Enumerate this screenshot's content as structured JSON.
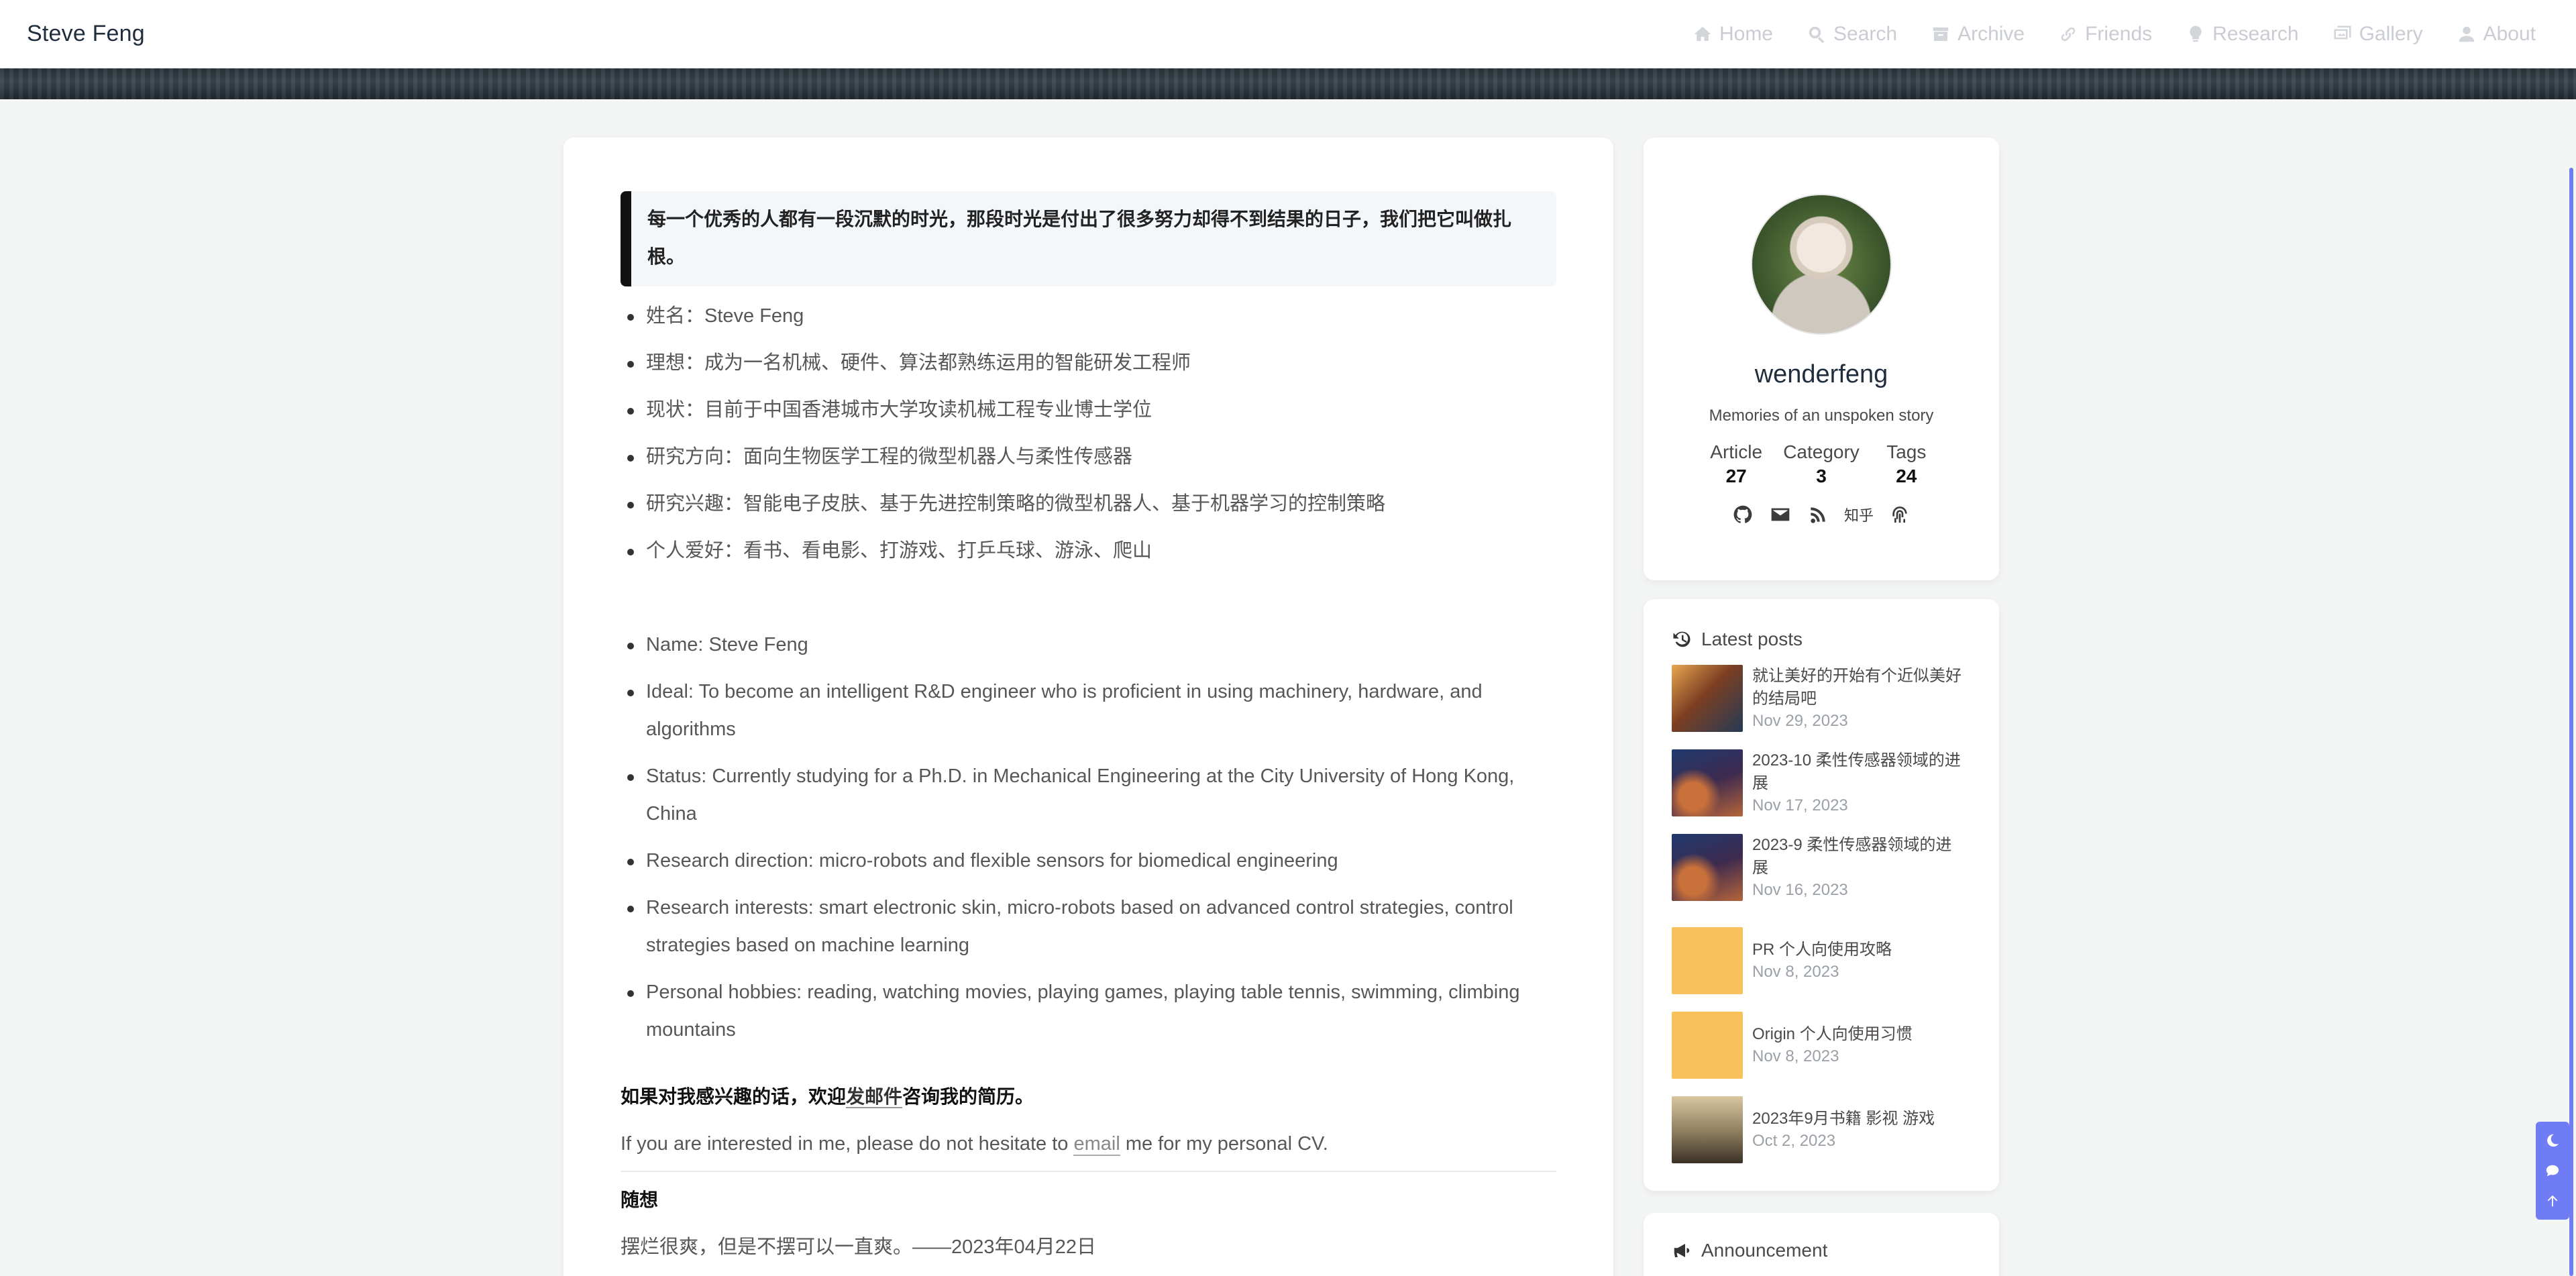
{
  "site_name": "Steve Feng",
  "nav": [
    {
      "label": "Home",
      "icon": "home-icon"
    },
    {
      "label": "Search",
      "icon": "search-icon"
    },
    {
      "label": "Archive",
      "icon": "archive-icon"
    },
    {
      "label": "Friends",
      "icon": "link-icon"
    },
    {
      "label": "Research",
      "icon": "bulb-icon"
    },
    {
      "label": "Gallery",
      "icon": "images-icon"
    },
    {
      "label": "About",
      "icon": "user-icon"
    }
  ],
  "article": {
    "quote": "每一个优秀的人都有一段沉默的时光，那段时光是付出了很多努力却得不到结果的日子，我们把它叫做扎根。",
    "cn_items": [
      "姓名：Steve Feng",
      "理想：成为一名机械、硬件、算法都熟练运用的智能研发工程师",
      "现状：目前于中国香港城市大学攻读机械工程专业博士学位",
      "研究方向：面向生物医学工程的微型机器人与柔性传感器",
      "研究兴趣：智能电子皮肤、基于先进控制策略的微型机器人、基于机器学习的控制策略",
      "个人爱好：看书、看电影、打游戏、打乒乓球、游泳、爬山"
    ],
    "en_items": [
      "Name: Steve Feng",
      "Ideal: To become an intelligent R&D engineer who is proficient in using machinery, hardware, and algorithms",
      "Status: Currently studying for a Ph.D. in Mechanical Engineering at the City University of Hong Kong, China",
      "Research direction: micro-robots and flexible sensors for biomedical engineering",
      "Research interests: smart electronic skin, micro-robots based on advanced control strategies, control strategies based on machine learning",
      "Personal hobbies: reading, watching movies, playing games, playing table tennis, swimming, climbing mountains"
    ],
    "contact_cn_before": "如果对我感兴趣的话，欢迎",
    "contact_cn_link": "发邮件",
    "contact_cn_after": "咨询我的简历。",
    "contact_en_before": "If you are interested in me, please do not hesitate to ",
    "contact_en_link": "email",
    "contact_en_after": " me for my personal CV.",
    "musings_title": "随想",
    "musing_1": "摆烂很爽，但是不摆可以一直爽。——2023年04月22日"
  },
  "author": {
    "name": "wenderfeng",
    "description": "Memories of an unspoken story",
    "stats": [
      {
        "label": "Article",
        "value": "27"
      },
      {
        "label": "Category",
        "value": "3"
      },
      {
        "label": "Tags",
        "value": "24"
      }
    ],
    "socials": [
      "github-icon",
      "mail-icon",
      "rss-icon",
      "zhihu-icon",
      "fingerprint-icon"
    ],
    "zhihu_label": "知乎"
  },
  "latest": {
    "title": "Latest posts",
    "posts": [
      {
        "title": "就让美好的开始有个近似美好的结局吧",
        "date": "Nov 29, 2023",
        "thumb": "#8a5a3a"
      },
      {
        "title": "2023-10 柔性传感器领域的进展",
        "date": "Nov 17, 2023",
        "thumb": "#2f3d6b"
      },
      {
        "title": "2023-9 柔性传感器领域的进展",
        "date": "Nov 16, 2023",
        "thumb": "#2f3d6b"
      },
      {
        "title": "PR 个人向使用攻略",
        "date": "Nov 8, 2023",
        "thumb": "#f8c15b"
      },
      {
        "title": "Origin 个人向使用习惯",
        "date": "Nov 8, 2023",
        "thumb": "#f8c15b"
      },
      {
        "title": "2023年9月书籍 影视 游戏",
        "date": "Oct 2, 2023",
        "thumb": "#8b7b5c"
      }
    ]
  },
  "announcement": {
    "title": "Announcement"
  },
  "colors": {
    "accent": "#6f7cf3",
    "nav_text": "#c9cdd3"
  }
}
